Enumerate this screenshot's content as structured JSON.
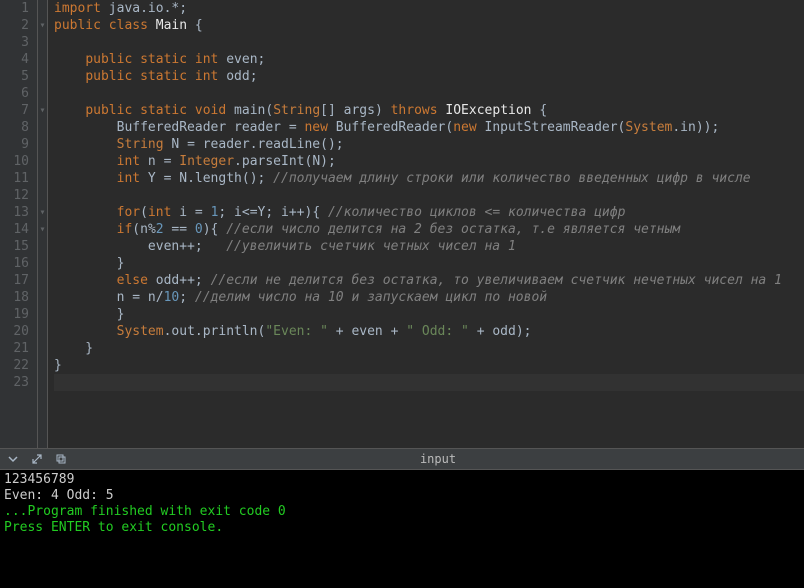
{
  "editor": {
    "lines": [
      {
        "num": 1,
        "fold": "",
        "tokens": [
          {
            "t": "kw",
            "v": "import"
          },
          {
            "t": "op",
            "v": " java.io."
          },
          {
            "t": "op",
            "v": "*"
          },
          {
            "t": "op",
            "v": ";"
          }
        ]
      },
      {
        "num": 2,
        "fold": "▾",
        "tokens": [
          {
            "t": "kw",
            "v": "public"
          },
          {
            "t": "op",
            "v": " "
          },
          {
            "t": "kw",
            "v": "class"
          },
          {
            "t": "op",
            "v": " "
          },
          {
            "t": "white",
            "v": "Main"
          },
          {
            "t": "op",
            "v": " {"
          }
        ]
      },
      {
        "num": 3,
        "fold": "",
        "tokens": []
      },
      {
        "num": 4,
        "fold": "",
        "tokens": [
          {
            "t": "op",
            "v": "    "
          },
          {
            "t": "kw",
            "v": "public"
          },
          {
            "t": "op",
            "v": " "
          },
          {
            "t": "kw",
            "v": "static"
          },
          {
            "t": "op",
            "v": " "
          },
          {
            "t": "kw",
            "v": "int"
          },
          {
            "t": "op",
            "v": " even;"
          }
        ]
      },
      {
        "num": 5,
        "fold": "",
        "tokens": [
          {
            "t": "op",
            "v": "    "
          },
          {
            "t": "kw",
            "v": "public"
          },
          {
            "t": "op",
            "v": " "
          },
          {
            "t": "kw",
            "v": "static"
          },
          {
            "t": "op",
            "v": " "
          },
          {
            "t": "kw",
            "v": "int"
          },
          {
            "t": "op",
            "v": " odd;"
          }
        ]
      },
      {
        "num": 6,
        "fold": "",
        "tokens": []
      },
      {
        "num": 7,
        "fold": "▾",
        "tokens": [
          {
            "t": "op",
            "v": "    "
          },
          {
            "t": "kw",
            "v": "public"
          },
          {
            "t": "op",
            "v": " "
          },
          {
            "t": "kw",
            "v": "static"
          },
          {
            "t": "op",
            "v": " "
          },
          {
            "t": "kw",
            "v": "void"
          },
          {
            "t": "op",
            "v": " main("
          },
          {
            "t": "cls",
            "v": "String"
          },
          {
            "t": "op",
            "v": "[] args) "
          },
          {
            "t": "kw",
            "v": "throws"
          },
          {
            "t": "op",
            "v": " "
          },
          {
            "t": "white",
            "v": "IOException"
          },
          {
            "t": "op",
            "v": " {"
          }
        ]
      },
      {
        "num": 8,
        "fold": "",
        "tokens": [
          {
            "t": "op",
            "v": "        BufferedReader reader "
          },
          {
            "t": "op",
            "v": "="
          },
          {
            "t": "op",
            "v": " "
          },
          {
            "t": "kw",
            "v": "new"
          },
          {
            "t": "op",
            "v": " BufferedReader("
          },
          {
            "t": "kw",
            "v": "new"
          },
          {
            "t": "op",
            "v": " InputStreamReader("
          },
          {
            "t": "cls",
            "v": "System"
          },
          {
            "t": "op",
            "v": ".in));"
          }
        ]
      },
      {
        "num": 9,
        "fold": "",
        "tokens": [
          {
            "t": "op",
            "v": "        "
          },
          {
            "t": "cls",
            "v": "String"
          },
          {
            "t": "op",
            "v": " N "
          },
          {
            "t": "op",
            "v": "="
          },
          {
            "t": "op",
            "v": " reader.readLine();"
          }
        ]
      },
      {
        "num": 10,
        "fold": "",
        "tokens": [
          {
            "t": "op",
            "v": "        "
          },
          {
            "t": "kw",
            "v": "int"
          },
          {
            "t": "op",
            "v": " n "
          },
          {
            "t": "op",
            "v": "="
          },
          {
            "t": "op",
            "v": " "
          },
          {
            "t": "cls",
            "v": "Integer"
          },
          {
            "t": "op",
            "v": ".parseInt(N);"
          }
        ]
      },
      {
        "num": 11,
        "fold": "",
        "tokens": [
          {
            "t": "op",
            "v": "        "
          },
          {
            "t": "kw",
            "v": "int"
          },
          {
            "t": "op",
            "v": " Y "
          },
          {
            "t": "op",
            "v": "="
          },
          {
            "t": "op",
            "v": " N.length(); "
          },
          {
            "t": "comment",
            "v": "//получаем длину строки или количество введенных цифр в числе"
          }
        ]
      },
      {
        "num": 12,
        "fold": "",
        "tokens": []
      },
      {
        "num": 13,
        "fold": "▾",
        "tokens": [
          {
            "t": "op",
            "v": "        "
          },
          {
            "t": "kw",
            "v": "for"
          },
          {
            "t": "op",
            "v": "("
          },
          {
            "t": "kw",
            "v": "int"
          },
          {
            "t": "op",
            "v": " i "
          },
          {
            "t": "op",
            "v": "="
          },
          {
            "t": "op",
            "v": " "
          },
          {
            "t": "num",
            "v": "1"
          },
          {
            "t": "op",
            "v": "; i"
          },
          {
            "t": "op",
            "v": "<="
          },
          {
            "t": "op",
            "v": "Y; i"
          },
          {
            "t": "op",
            "v": "++"
          },
          {
            "t": "op",
            "v": "){ "
          },
          {
            "t": "comment",
            "v": "//количество циклов <= количества цифр"
          }
        ]
      },
      {
        "num": 14,
        "fold": "▾",
        "tokens": [
          {
            "t": "op",
            "v": "        "
          },
          {
            "t": "kw",
            "v": "if"
          },
          {
            "t": "op",
            "v": "(n"
          },
          {
            "t": "op",
            "v": "%"
          },
          {
            "t": "num",
            "v": "2"
          },
          {
            "t": "op",
            "v": " "
          },
          {
            "t": "op",
            "v": "=="
          },
          {
            "t": "op",
            "v": " "
          },
          {
            "t": "num",
            "v": "0"
          },
          {
            "t": "op",
            "v": "){ "
          },
          {
            "t": "comment",
            "v": "//если число делится на 2 без остатка, т.е является четным"
          }
        ]
      },
      {
        "num": 15,
        "fold": "",
        "tokens": [
          {
            "t": "op",
            "v": "            even"
          },
          {
            "t": "op",
            "v": "++"
          },
          {
            "t": "op",
            "v": ";   "
          },
          {
            "t": "comment",
            "v": "//увеличить счетчик четных чисел на 1"
          }
        ]
      },
      {
        "num": 16,
        "fold": "",
        "tokens": [
          {
            "t": "op",
            "v": "        }"
          }
        ]
      },
      {
        "num": 17,
        "fold": "",
        "tokens": [
          {
            "t": "op",
            "v": "        "
          },
          {
            "t": "kw",
            "v": "else"
          },
          {
            "t": "op",
            "v": " odd"
          },
          {
            "t": "op",
            "v": "++"
          },
          {
            "t": "op",
            "v": "; "
          },
          {
            "t": "comment",
            "v": "//если не делится без остатка, то увеличиваем счетчик нечетных чисел на 1"
          }
        ]
      },
      {
        "num": 18,
        "fold": "",
        "tokens": [
          {
            "t": "op",
            "v": "        n "
          },
          {
            "t": "op",
            "v": "="
          },
          {
            "t": "op",
            "v": " n"
          },
          {
            "t": "op",
            "v": "/"
          },
          {
            "t": "num",
            "v": "10"
          },
          {
            "t": "op",
            "v": "; "
          },
          {
            "t": "comment",
            "v": "//делим число на 10 и запускаем цикл по новой"
          }
        ]
      },
      {
        "num": 19,
        "fold": "",
        "tokens": [
          {
            "t": "op",
            "v": "        }"
          }
        ]
      },
      {
        "num": 20,
        "fold": "",
        "tokens": [
          {
            "t": "op",
            "v": "        "
          },
          {
            "t": "cls",
            "v": "System"
          },
          {
            "t": "op",
            "v": ".out.println("
          },
          {
            "t": "str",
            "v": "\"Even: \""
          },
          {
            "t": "op",
            "v": " "
          },
          {
            "t": "op",
            "v": "+"
          },
          {
            "t": "op",
            "v": " even "
          },
          {
            "t": "op",
            "v": "+"
          },
          {
            "t": "op",
            "v": " "
          },
          {
            "t": "str",
            "v": "\" Odd: \""
          },
          {
            "t": "op",
            "v": " "
          },
          {
            "t": "op",
            "v": "+"
          },
          {
            "t": "op",
            "v": " odd);"
          }
        ]
      },
      {
        "num": 21,
        "fold": "",
        "tokens": [
          {
            "t": "op",
            "v": "    }"
          }
        ]
      },
      {
        "num": 22,
        "fold": "",
        "tokens": [
          {
            "t": "op",
            "v": "}"
          }
        ]
      },
      {
        "num": 23,
        "fold": "",
        "tokens": [],
        "cursor": true
      }
    ]
  },
  "toolbar": {
    "tab_label": "input"
  },
  "console": {
    "lines": [
      {
        "text": "123456789",
        "class": ""
      },
      {
        "text": "Even: 4 Odd: 5",
        "class": ""
      },
      {
        "text": "",
        "class": ""
      },
      {
        "text": "",
        "class": ""
      },
      {
        "text": "...Program finished with exit code 0",
        "class": "console-green"
      },
      {
        "text": "Press ENTER to exit console.",
        "class": "console-green"
      }
    ]
  }
}
